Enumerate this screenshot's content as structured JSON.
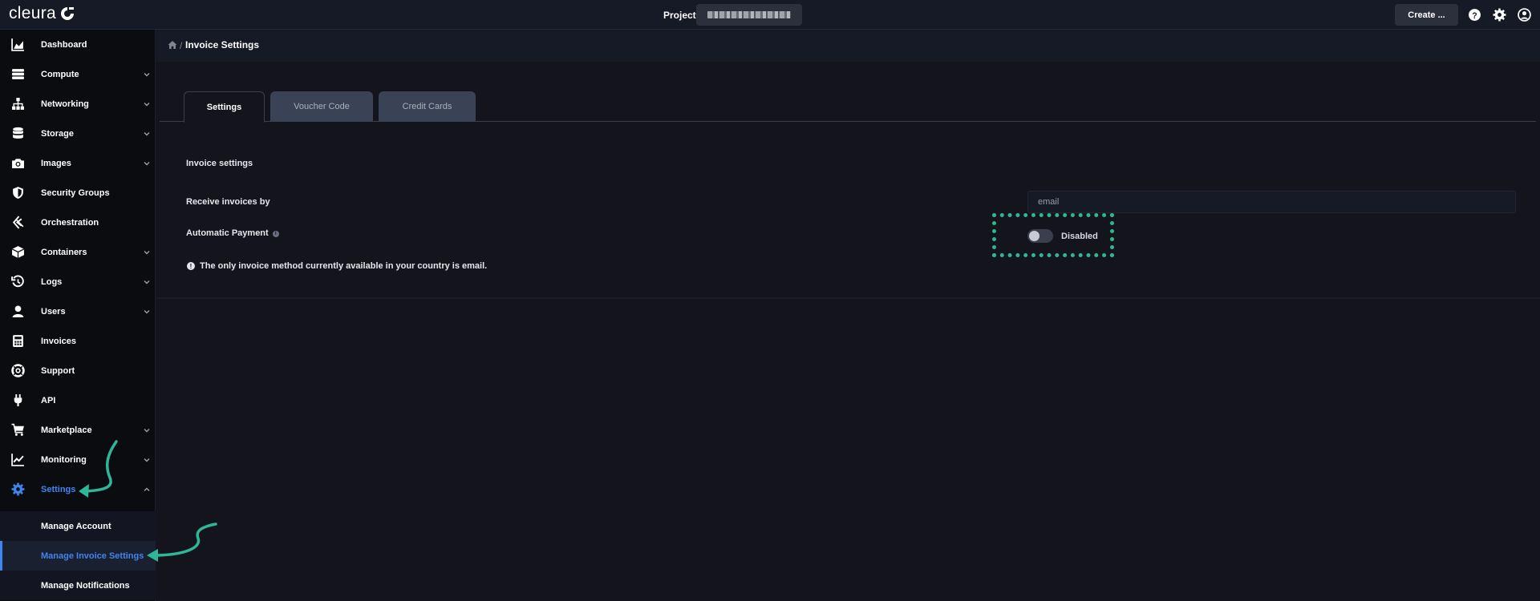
{
  "brand": {
    "name": "cleura"
  },
  "topbar": {
    "project_label": "Project",
    "create_label": "Create ...",
    "icons": [
      "help-icon",
      "gear-icon",
      "account-icon"
    ]
  },
  "sidebar": {
    "items": [
      {
        "label": "Dashboard",
        "icon": "chart-area-icon",
        "expandable": false
      },
      {
        "label": "Compute",
        "icon": "server-icon",
        "expandable": true
      },
      {
        "label": "Networking",
        "icon": "network-icon",
        "expandable": true
      },
      {
        "label": "Storage",
        "icon": "database-icon",
        "expandable": true
      },
      {
        "label": "Images",
        "icon": "camera-icon",
        "expandable": true
      },
      {
        "label": "Security Groups",
        "icon": "shield-icon",
        "expandable": false
      },
      {
        "label": "Orchestration",
        "icon": "orchestration-icon",
        "expandable": false
      },
      {
        "label": "Containers",
        "icon": "cube-icon",
        "expandable": true
      },
      {
        "label": "Logs",
        "icon": "history-icon",
        "expandable": true
      },
      {
        "label": "Users",
        "icon": "user-icon",
        "expandable": true
      },
      {
        "label": "Invoices",
        "icon": "calculator-icon",
        "expandable": false
      },
      {
        "label": "Support",
        "icon": "lifebuoy-icon",
        "expandable": false
      },
      {
        "label": "API",
        "icon": "plug-icon",
        "expandable": false
      },
      {
        "label": "Marketplace",
        "icon": "cart-icon",
        "expandable": true
      },
      {
        "label": "Monitoring",
        "icon": "line-chart-icon",
        "expandable": true
      },
      {
        "label": "Settings",
        "icon": "gear-icon",
        "expandable": true,
        "expanded": true,
        "active": true
      }
    ],
    "settings_sub": [
      {
        "label": "Manage Account"
      },
      {
        "label": "Manage Invoice Settings",
        "current": true
      },
      {
        "label": "Manage Notifications"
      }
    ]
  },
  "breadcrumb": {
    "separator": "/",
    "title": "Invoice Settings"
  },
  "tabs": [
    {
      "label": "Settings",
      "active": true
    },
    {
      "label": "Voucher Code",
      "active": false
    },
    {
      "label": "Credit Cards",
      "active": false
    }
  ],
  "form": {
    "section_title": "Invoice settings",
    "receive_label": "Receive invoices by",
    "receive_value": "email",
    "auto_payment_label": "Automatic Payment",
    "auto_payment_state": "Disabled",
    "auto_payment_enabled": false,
    "notice": "The only invoice method currently available in your country is email."
  },
  "colors": {
    "accent": "#3d86f0",
    "annotation": "#2fb597",
    "sidebar_bg": "#0b0c10",
    "topbar_bg": "#161a26",
    "main_bg": "#14151c"
  }
}
